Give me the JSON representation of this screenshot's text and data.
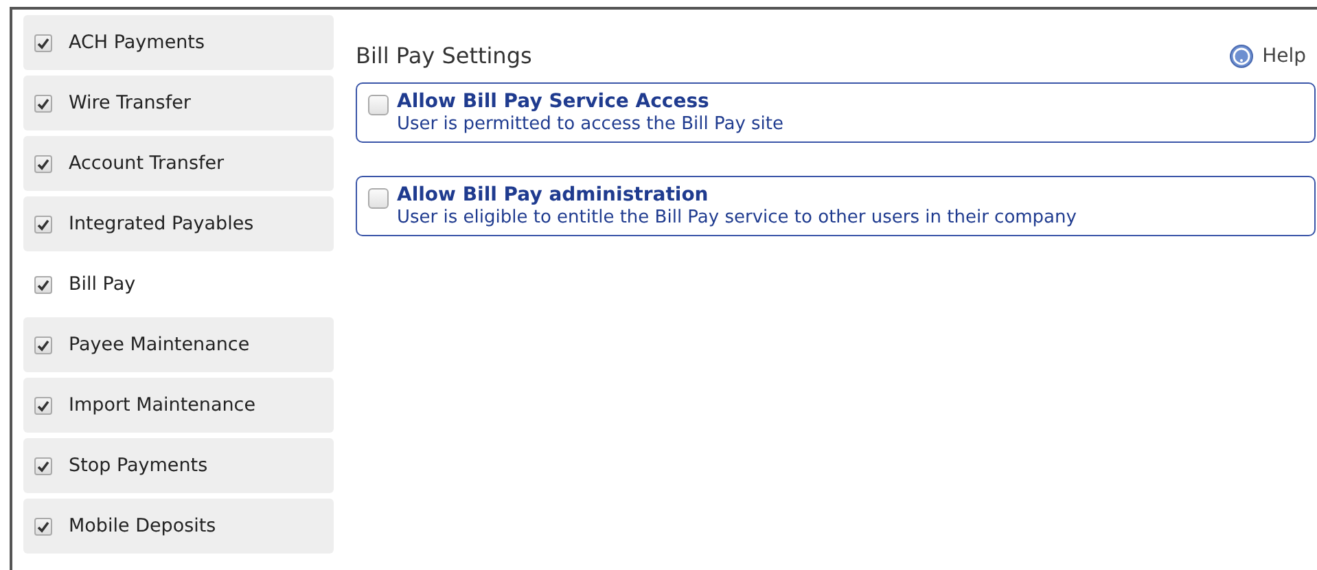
{
  "sidebar": {
    "items": [
      {
        "label": "ACH Payments",
        "checked": true,
        "selected": false
      },
      {
        "label": "Wire Transfer",
        "checked": true,
        "selected": false
      },
      {
        "label": "Account Transfer",
        "checked": true,
        "selected": false
      },
      {
        "label": "Integrated Payables",
        "checked": true,
        "selected": false
      },
      {
        "label": "Bill Pay",
        "checked": true,
        "selected": true
      },
      {
        "label": "Payee Maintenance",
        "checked": true,
        "selected": false
      },
      {
        "label": "Import Maintenance",
        "checked": true,
        "selected": false
      },
      {
        "label": "Stop Payments",
        "checked": true,
        "selected": false
      },
      {
        "label": "Mobile Deposits",
        "checked": true,
        "selected": false
      }
    ]
  },
  "panel": {
    "title": "Bill Pay Settings",
    "help": "Help",
    "settings": [
      {
        "title": "Allow Bill Pay Service Access",
        "description": "User is permitted to access the Bill Pay site",
        "checked": false
      },
      {
        "title": "Allow Bill Pay administration",
        "description": "User is eligible to entitle the Bill Pay service to other users in their company",
        "checked": false
      }
    ]
  }
}
